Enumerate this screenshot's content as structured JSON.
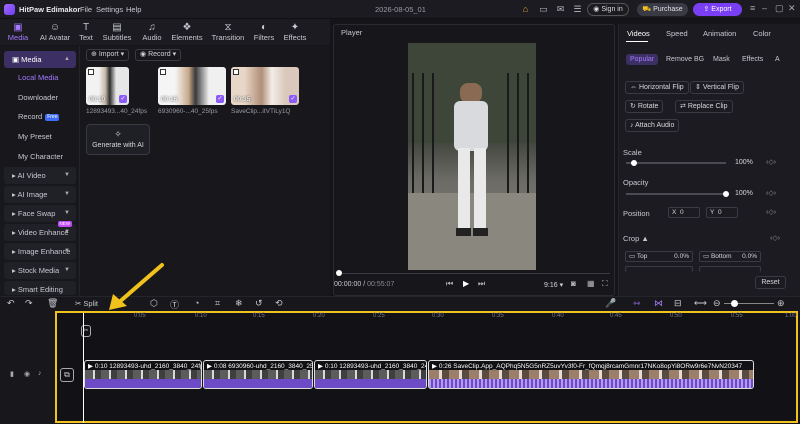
{
  "app": {
    "name": "HitPaw Edimakor",
    "menus": [
      "File",
      "Settings",
      "Help"
    ],
    "doc_title": "2026-08-05_01"
  },
  "header": {
    "signin": "Sign in",
    "purchase": "Purchase",
    "export": "Export"
  },
  "tool_tabs": [
    {
      "label": "Media",
      "icon": "media-icon"
    },
    {
      "label": "AI Avatar",
      "icon": "avatar-icon"
    },
    {
      "label": "Text",
      "icon": "text-icon"
    },
    {
      "label": "Subtitles",
      "icon": "subtitles-icon"
    },
    {
      "label": "Audio",
      "icon": "audio-icon"
    },
    {
      "label": "Elements",
      "icon": "elements-icon"
    },
    {
      "label": "Transition",
      "icon": "transition-icon"
    },
    {
      "label": "Filters",
      "icon": "filters-icon"
    },
    {
      "label": "Effects",
      "icon": "effects-icon"
    }
  ],
  "sidebar": {
    "media": "Media",
    "items": [
      "Local Media",
      "Downloader",
      "Record",
      "My Preset",
      "My Character"
    ],
    "free_badge": "Free",
    "groups": [
      "AI Video",
      "AI Image",
      "Face Swap",
      "Video Enhance",
      "Image Enhance",
      "Stock Media",
      "Smart Editing"
    ],
    "new_badge": "NEW"
  },
  "media": {
    "import": "Import",
    "record": "Record",
    "clips": [
      {
        "duration": "00:10",
        "name": "12893493...40_24fps"
      },
      {
        "duration": "00:16",
        "name": "6930960-...40_25fps"
      },
      {
        "duration": "00:35",
        "name": "SaveClip...itVTiLy1Q"
      }
    ],
    "generate": "Generate with AI"
  },
  "player": {
    "label": "Player",
    "current": "00:00:00",
    "total": "00:55:07",
    "aspect": "9:16"
  },
  "right_panel": {
    "tabs": [
      "Videos",
      "Speed",
      "Animation",
      "Color"
    ],
    "subtabs": [
      "Popular",
      "Remove BG",
      "Mask",
      "Effects",
      "A"
    ],
    "actions": [
      "Horizontal Flip",
      "Vertical Flip",
      "Rotate",
      "Replace Clip",
      "Attach Audio"
    ],
    "scale_label": "Scale",
    "scale_value": "100%",
    "scale_pct": 8,
    "opacity_label": "Opacity",
    "opacity_value": "100%",
    "opacity_pct": 100,
    "position_label": "Position",
    "pos_x_label": "X",
    "pos_x": "0",
    "pos_y_label": "Y",
    "pos_y": "0",
    "crop_label": "Crop",
    "crop_top_label": "Top",
    "crop_top": "0.0%",
    "crop_bottom_label": "Bottom",
    "crop_bottom": "0.0%",
    "reset": "Reset"
  },
  "toolbar": {
    "split": "Split"
  },
  "timeline": {
    "ruler": [
      "0:05",
      "0:10",
      "0:15",
      "0:20",
      "0:25",
      "0:30",
      "0:35",
      "0:40",
      "0:45",
      "0:50",
      "0:55",
      "1:00"
    ],
    "clips": [
      {
        "time": "0:10",
        "name": "12893493-uhd_2160_3840_24fps"
      },
      {
        "time": "0:08",
        "name": "6930960-uhd_2160_3840_25fps"
      },
      {
        "time": "0:10",
        "name": "12893493-uhd_2160_3840_24fps"
      },
      {
        "time": "0:26",
        "name": "SaveClip.App_AQPhq5N5G5nRZ5uvYv3f0-Fr_fQmqj8rcamGmnr17NKo8opYi8ORw9r6e7NvN20347"
      }
    ]
  },
  "colors": {
    "accent": "#7a3ff5",
    "highlight": "#f1c21b",
    "panel": "#1b1b21"
  }
}
